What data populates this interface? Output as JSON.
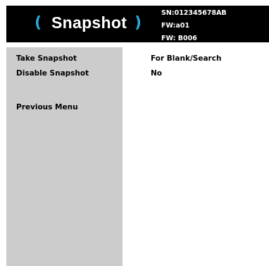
{
  "header": {
    "title": "Snapshot",
    "left_paren": "(",
    "right_paren": ")",
    "serial": "SN:012345678AB",
    "fw_line1": "FW:a01",
    "fw_line2": "FW: B006",
    "accent_color": "#2aa8d8"
  },
  "menu": {
    "items": [
      {
        "label": "Take Snapshot",
        "value": "For Blank/Search"
      },
      {
        "label": "Disable Snapshot",
        "value": "No"
      },
      {
        "label": "Previous Menu"
      }
    ]
  }
}
